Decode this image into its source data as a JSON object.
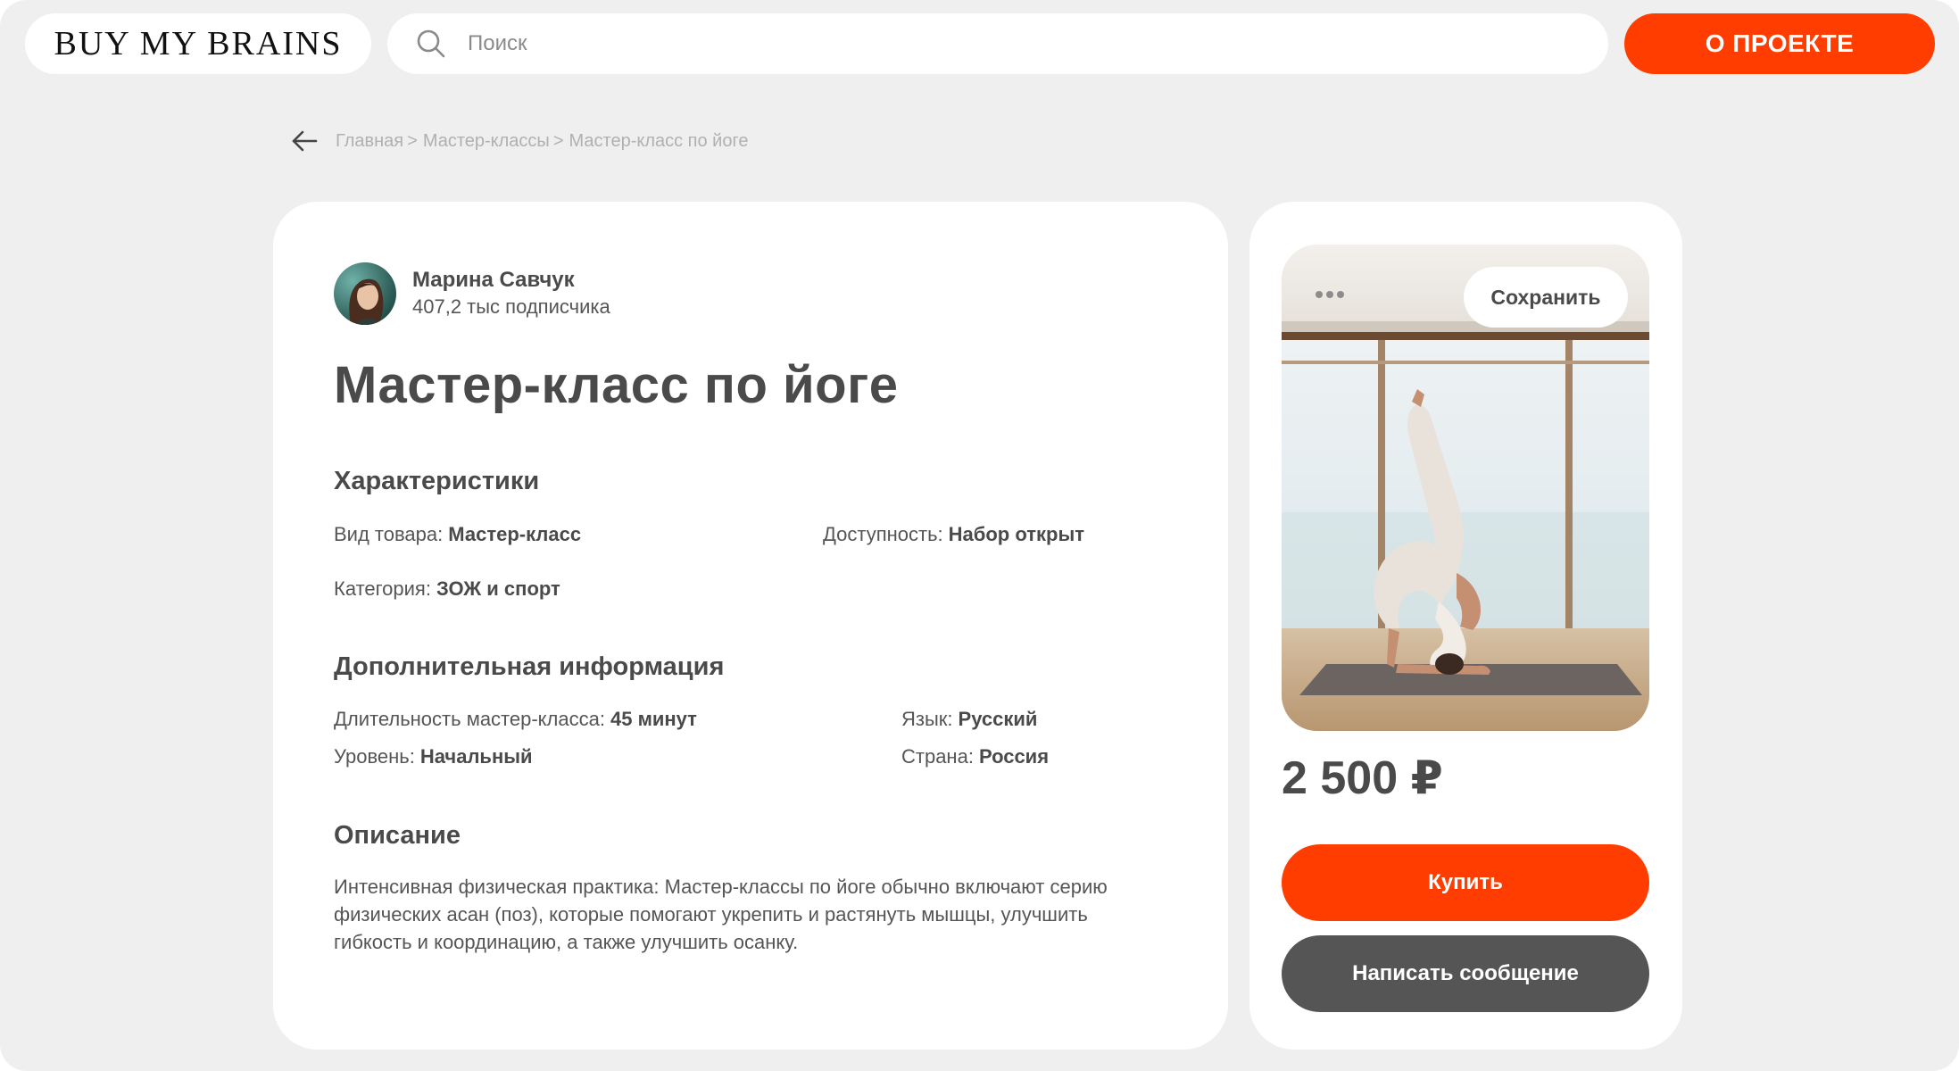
{
  "header": {
    "logo": "BUY MY BRAINS",
    "search_placeholder": "Поиск",
    "about_label": "О ПРОЕКТЕ"
  },
  "breadcrumb": {
    "items": [
      "Главная",
      "Мастер-классы",
      "Мастер-класс по йоге"
    ],
    "separator": ">"
  },
  "author": {
    "name": "Марина Савчук",
    "subscribers": "407,2 тыс подписчика"
  },
  "product": {
    "title": "Мастер-класс по йоге",
    "characteristics": {
      "heading": "Характеристики",
      "type_label": "Вид товара:",
      "type_value": "Мастер-класс",
      "availability_label": "Доступность:",
      "availability_value": "Набор открыт",
      "category_label": "Категория:",
      "category_value": "ЗОЖ и спорт"
    },
    "additional": {
      "heading": "Дополнительная информация",
      "duration_label": "Длительность мастер-класса:",
      "duration_value": "45 минут",
      "language_label": "Язык:",
      "language_value": "Русский",
      "level_label": "Уровень:",
      "level_value": "Начальный",
      "country_label": "Страна:",
      "country_value": "Россия"
    },
    "description": {
      "heading": "Описание",
      "text": "Интенсивная физическая практика: Мастер-классы по йоге обычно включают серию физических асан (поз), которые помогают укрепить и растянуть мышцы, улучшить гибкость и координацию, а также улучшить осанку."
    }
  },
  "side": {
    "save_label": "Сохранить",
    "price": "2 500 ₽",
    "buy_label": "Купить",
    "message_label": "Написать сообщение"
  },
  "colors": {
    "accent": "#ff3d00",
    "background": "#efefef",
    "text": "#4a4a4a",
    "secondary_button": "#555555"
  },
  "icons": [
    "search-icon",
    "arrow-left-icon"
  ]
}
